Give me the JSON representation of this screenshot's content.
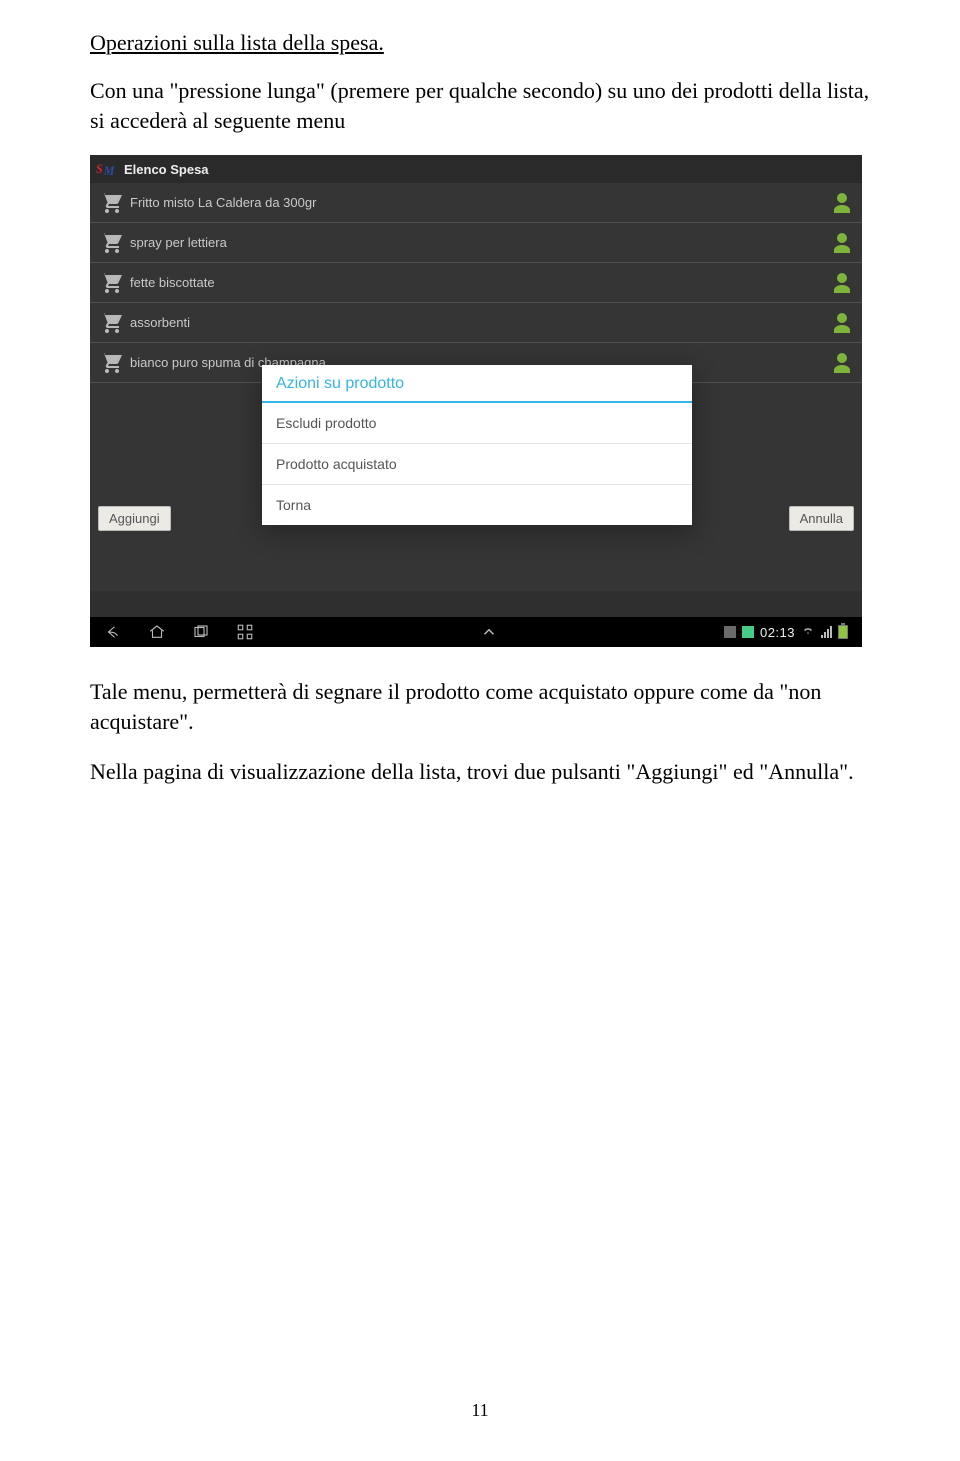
{
  "doc": {
    "heading": "Operazioni sulla lista della spesa.",
    "p1": "Con una \"pressione lunga\" (premere per qualche secondo) su uno dei prodotti della lista, si accederà al seguente menu",
    "p2": "Tale menu, permetterà di segnare il prodotto come acquistato oppure come da \"non acquistare\".",
    "p3": "Nella pagina di visualizzazione della lista, trovi due pulsanti \"Aggiungi\" ed \"Annulla\".",
    "page_number": "11"
  },
  "screenshot": {
    "header_title": "Elenco Spesa",
    "rows": [
      {
        "label": "Fritto misto La Caldera  da 300gr"
      },
      {
        "label": "spray per lettiera"
      },
      {
        "label": "fette biscottate"
      },
      {
        "label": "assorbenti"
      },
      {
        "label": "bianco puro spuma di champagna"
      }
    ],
    "buttons": {
      "add": "Aggiungi",
      "cancel": "Annulla"
    },
    "dialog": {
      "title": "Azioni su prodotto",
      "items": [
        "Escludi prodotto",
        "Prodotto acquistato",
        "Torna"
      ]
    },
    "clock": "02:13"
  }
}
